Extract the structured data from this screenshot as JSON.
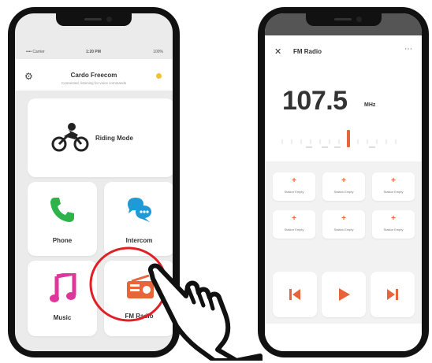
{
  "phone_home": {
    "status": {
      "carrier": "•••• Carrier",
      "time": "1:20 PM",
      "battery": "100%"
    },
    "header": {
      "title": "Cardo Freecom",
      "subtitle": "Connected, listening for voice commands"
    },
    "tiles": {
      "riding": "Riding Mode",
      "phone": "Phone",
      "intercom": "Intercom",
      "music": "Music",
      "fm": "FM Radio"
    }
  },
  "phone_fm": {
    "header": {
      "close": "✕",
      "title": "FM Radio",
      "more": "⋯"
    },
    "frequency": "107.5",
    "unit": "MHz",
    "presets": [
      "Station Empty",
      "Station Empty",
      "Station Empty",
      "Station Empty",
      "Station Empty",
      "Station Empty"
    ],
    "controls": {
      "prev": "previous",
      "play": "play",
      "next": "next"
    }
  },
  "colors": {
    "accent": "#e8643a",
    "highlight_ring": "#e02027",
    "phone_green": "#2db34a",
    "intercom_blue": "#1e9ad6",
    "music_pink": "#e0359a",
    "indicator_yellow": "#f2c230"
  }
}
